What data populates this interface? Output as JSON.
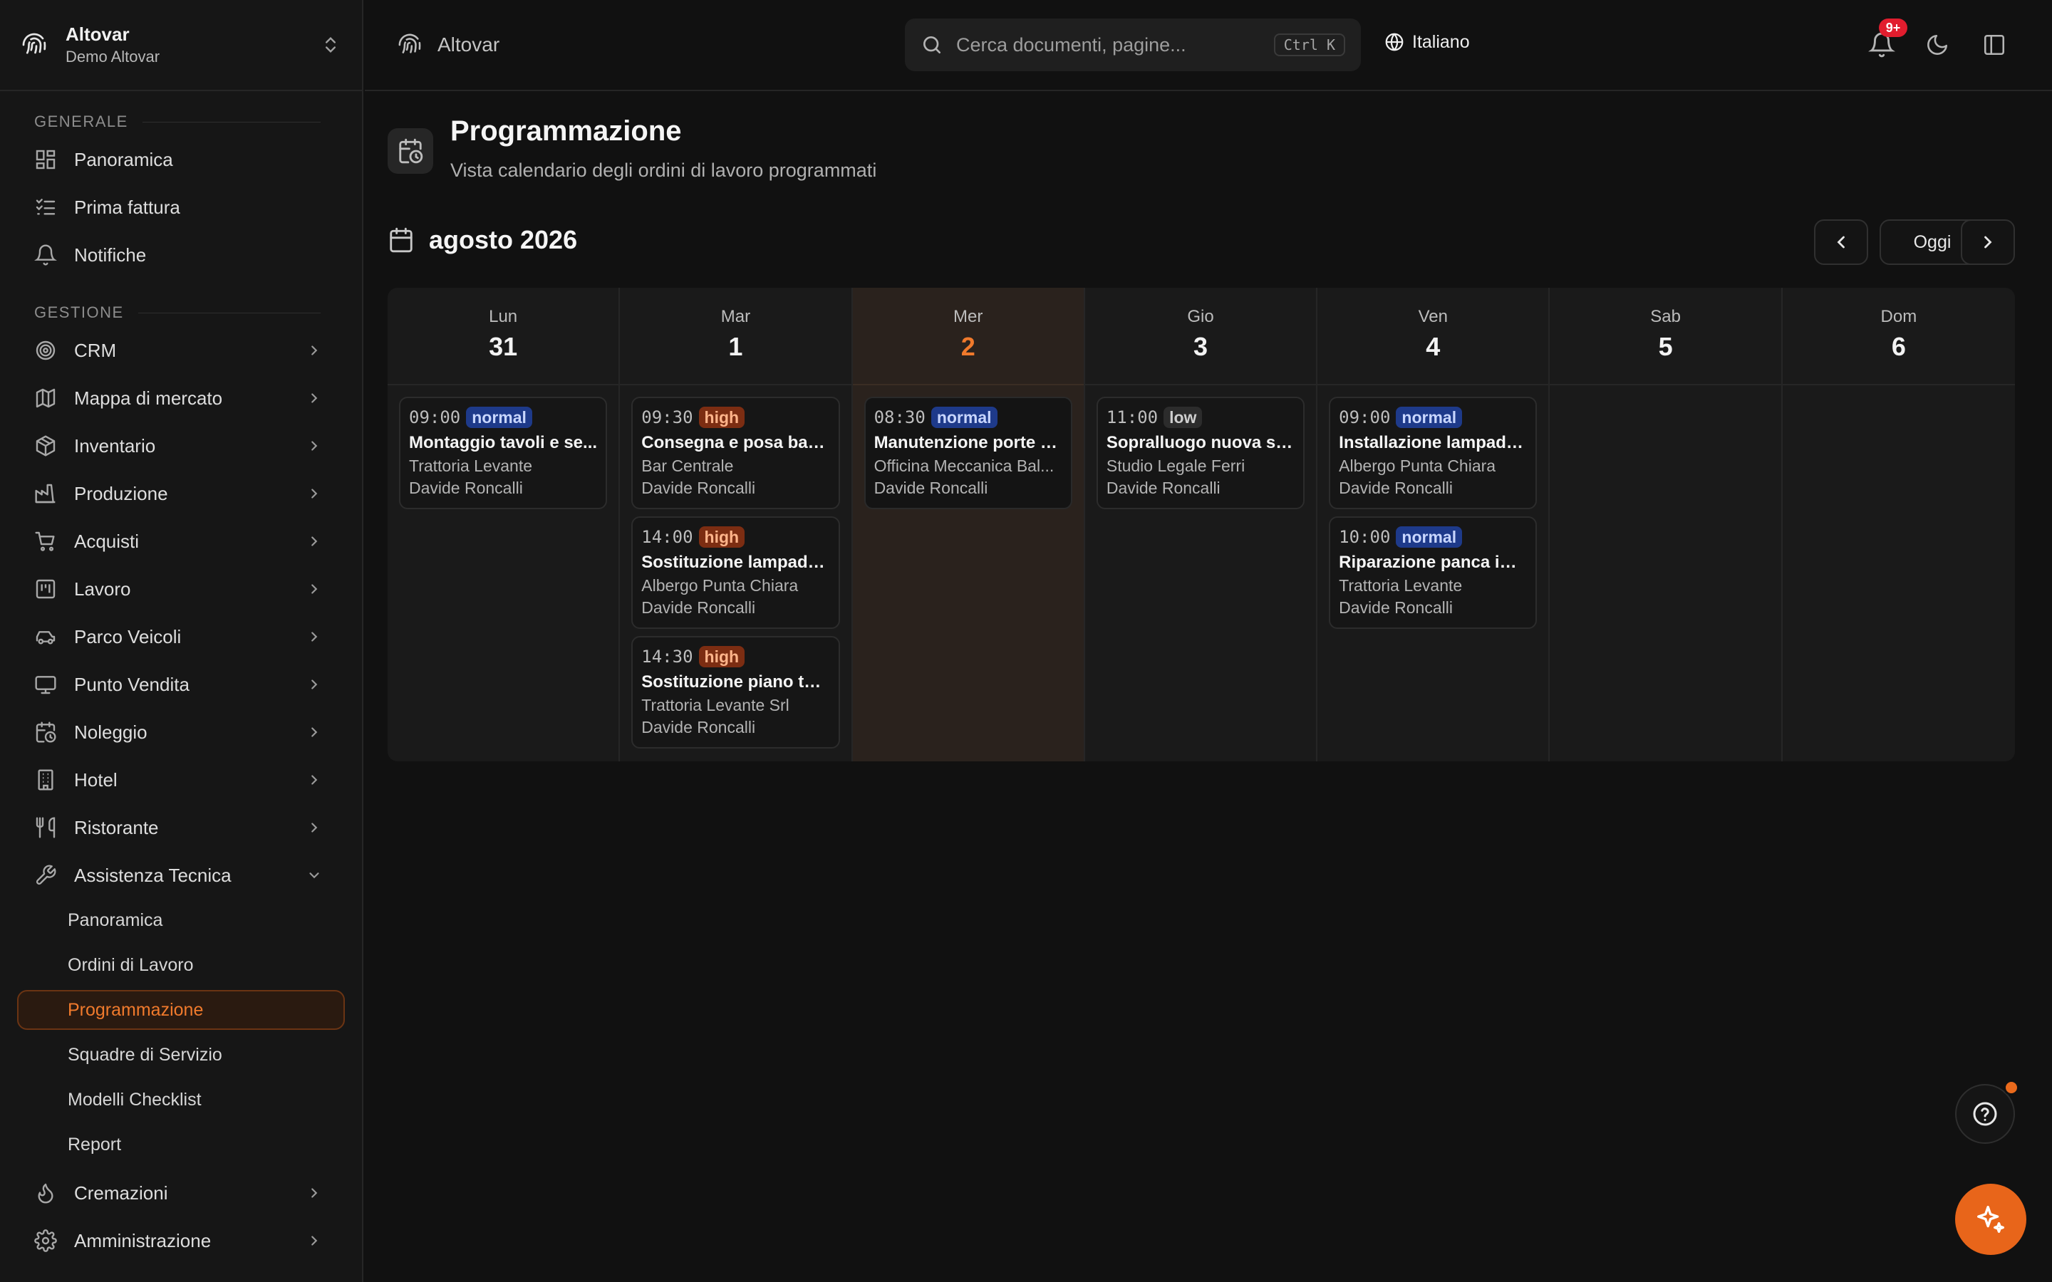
{
  "org": {
    "name": "Altovar",
    "subtitle": "Demo Altovar"
  },
  "header": {
    "brand": "Altovar",
    "search_placeholder": "Cerca documenti, pagine...",
    "search_shortcut": "Ctrl K",
    "language": "Italiano",
    "notification_badge": "9+"
  },
  "sidebar": {
    "groups": [
      {
        "label": "GENERALE"
      },
      {
        "label": "GESTIONE"
      }
    ],
    "general": [
      {
        "label": "Panoramica",
        "icon": "dashboard-icon"
      },
      {
        "label": "Prima fattura",
        "icon": "checklist-icon"
      },
      {
        "label": "Notifiche",
        "icon": "bell-icon"
      }
    ],
    "management": [
      {
        "label": "CRM",
        "icon": "target-icon"
      },
      {
        "label": "Mappa di mercato",
        "icon": "map-icon"
      },
      {
        "label": "Inventario",
        "icon": "package-icon"
      },
      {
        "label": "Produzione",
        "icon": "factory-icon"
      },
      {
        "label": "Acquisti",
        "icon": "cart-icon"
      },
      {
        "label": "Lavoro",
        "icon": "kanban-icon"
      },
      {
        "label": "Parco Veicoli",
        "icon": "car-icon"
      },
      {
        "label": "Punto Vendita",
        "icon": "monitor-icon"
      },
      {
        "label": "Noleggio",
        "icon": "calendar-clock-icon"
      },
      {
        "label": "Hotel",
        "icon": "building-icon"
      },
      {
        "label": "Ristorante",
        "icon": "utensils-icon"
      },
      {
        "label": "Assistenza Tecnica",
        "icon": "wrench-icon"
      }
    ],
    "assistenza_sub": [
      {
        "label": "Panoramica"
      },
      {
        "label": "Ordini di Lavoro"
      },
      {
        "label": "Programmazione",
        "active": true
      },
      {
        "label": "Squadre di Servizio"
      },
      {
        "label": "Modelli Checklist"
      },
      {
        "label": "Report"
      }
    ],
    "bottom": [
      {
        "label": "Cremazioni",
        "icon": "flame-icon"
      },
      {
        "label": "Amministrazione",
        "icon": "gear-icon"
      }
    ]
  },
  "page": {
    "title": "Programmazione",
    "subtitle": "Vista calendario degli ordini di lavoro programmati"
  },
  "calendar": {
    "month": "agosto 2026",
    "today_label": "Oggi",
    "days": [
      {
        "name": "Lun",
        "num": "31",
        "today": false,
        "events": [
          {
            "time": "09:00",
            "priority": "normal",
            "title": "Montaggio tavoli e se...",
            "client": "Trattoria Levante",
            "tech": "Davide Roncalli"
          }
        ]
      },
      {
        "name": "Mar",
        "num": "1",
        "today": false,
        "events": [
          {
            "time": "09:30",
            "priority": "high",
            "title": "Consegna e posa ban...",
            "client": "Bar Centrale",
            "tech": "Davide Roncalli"
          },
          {
            "time": "14:00",
            "priority": "high",
            "title": "Sostituzione lampade ...",
            "client": "Albergo Punta Chiara",
            "tech": "Davide Roncalli"
          },
          {
            "time": "14:30",
            "priority": "high",
            "title": "Sostituzione piano tav...",
            "client": "Trattoria Levante Srl",
            "tech": "Davide Roncalli"
          }
        ]
      },
      {
        "name": "Mer",
        "num": "2",
        "today": true,
        "events": [
          {
            "time": "08:30",
            "priority": "normal",
            "title": "Manutenzione porte s...",
            "client": "Officina Meccanica Bal...",
            "tech": "Davide Roncalli"
          }
        ]
      },
      {
        "name": "Gio",
        "num": "3",
        "today": false,
        "events": [
          {
            "time": "11:00",
            "priority": "low",
            "title": "Sopralluogo nuova sal...",
            "client": "Studio Legale Ferri",
            "tech": "Davide Roncalli"
          }
        ]
      },
      {
        "name": "Ven",
        "num": "4",
        "today": false,
        "events": [
          {
            "time": "09:00",
            "priority": "normal",
            "title": "Installazione lampade...",
            "client": "Albergo Punta Chiara",
            "tech": "Davide Roncalli"
          },
          {
            "time": "10:00",
            "priority": "normal",
            "title": "Riparazione panca im...",
            "client": "Trattoria Levante",
            "tech": "Davide Roncalli"
          }
        ]
      },
      {
        "name": "Sab",
        "num": "5",
        "today": false,
        "events": []
      },
      {
        "name": "Dom",
        "num": "6",
        "today": false,
        "events": []
      }
    ]
  },
  "colors": {
    "accent": "#f07a2c",
    "prio_normal": "#1e3a8a",
    "prio_high": "#7c2d12",
    "prio_low": "#2c2c2c",
    "notification": "#e11d2e"
  }
}
